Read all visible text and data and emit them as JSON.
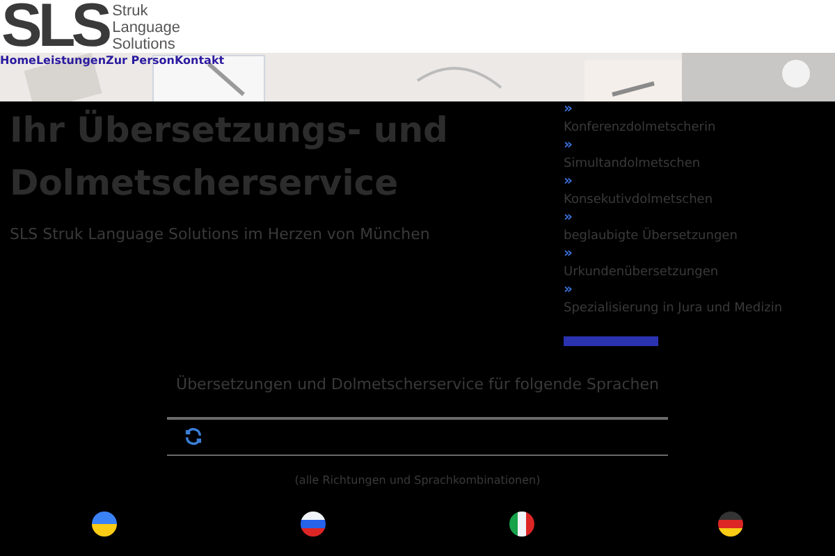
{
  "logo": {
    "mark": "SLS",
    "lines": [
      "Struk",
      "Language",
      "Solutions"
    ]
  },
  "nav": [
    "Home",
    "Leistungen",
    "Zur Person",
    "Kontakt"
  ],
  "hero": {
    "title": "Ihr Übersetzungs- und Dolmetscherservice",
    "subtitle": "SLS Struk Language Solutions im Herzen von München"
  },
  "services": [
    {
      "icon": "»",
      "label": "Konferenzdolmetscherin"
    },
    {
      "icon": "»",
      "label": "Simultandolmetschen"
    },
    {
      "icon": "»",
      "label": "Konsekutivdolmetschen"
    },
    {
      "icon": "»",
      "label": "beglaubigte Übersetzungen"
    },
    {
      "icon": "»",
      "label": "Urkundenübersetzungen"
    },
    {
      "icon": "»",
      "label": "Spezialisierung in Jura und Medizin"
    }
  ],
  "languages": {
    "title": "Übersetzungen und Dolmetscherservice für folgende Sprachen",
    "note": "(alle Richtungen und Sprachkombinationen)",
    "flags": [
      {
        "kind": "ukraine"
      },
      {
        "kind": "russia"
      },
      {
        "kind": "italy"
      },
      {
        "kind": "germany"
      }
    ]
  }
}
